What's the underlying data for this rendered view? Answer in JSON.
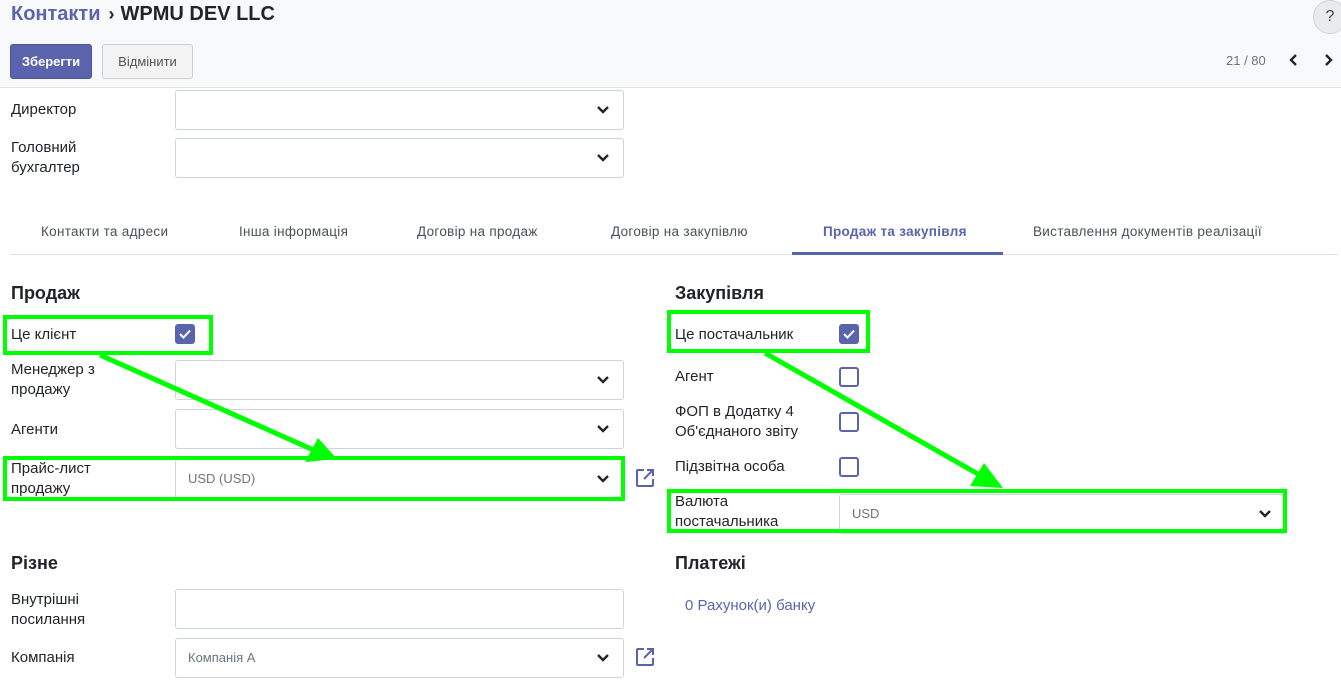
{
  "breadcrumb": {
    "parent": "Контакти",
    "separator": "›",
    "current": "WPMU DEV LLC"
  },
  "help": "?",
  "toolbar": {
    "save": "Зберегти",
    "cancel": "Відмінити"
  },
  "pager": {
    "text": "21 / 80",
    "prev": "‹",
    "next": "›"
  },
  "top_fields": {
    "director": "Директор",
    "chief_accountant": "Головний бухгалтер"
  },
  "tabs": [
    {
      "label": "Контакти та адреси"
    },
    {
      "label": "Інша інформація"
    },
    {
      "label": "Договір на продаж"
    },
    {
      "label": "Договір на закупівлю"
    },
    {
      "label": "Продаж та закупівля",
      "active": true
    },
    {
      "label": "Виставлення документів реалізації"
    }
  ],
  "sales": {
    "heading": "Продаж",
    "is_customer_label": "Це клієнт",
    "is_customer": true,
    "sales_manager_label": "Менеджер з продажу",
    "agents_label": "Агенти",
    "pricelist_label": "Прайс-лист продажу",
    "pricelist_value": "USD (USD)"
  },
  "purchase": {
    "heading": "Закупівля",
    "is_vendor_label": "Це постачальник",
    "is_vendor": true,
    "agent_label": "Агент",
    "agent": false,
    "fop_label": "ФОП в Додатку 4 Об'єднаного звіту",
    "fop": false,
    "legal_entity_label": "Підзвітна особа",
    "legal_entity": false,
    "currency_label": "Валюта постачальника",
    "currency_value": "USD"
  },
  "misc": {
    "heading": "Різне",
    "internal_ref_label": "Внутрішні посилання",
    "internal_ref_value": "",
    "company_label": "Компанія",
    "company_value": "Компанія А"
  },
  "payments": {
    "heading": "Платежі",
    "bank_accounts": "0 Рахунок(и) банку"
  },
  "colors": {
    "accent": "#5a64ad",
    "highlight": "#00ff00"
  }
}
